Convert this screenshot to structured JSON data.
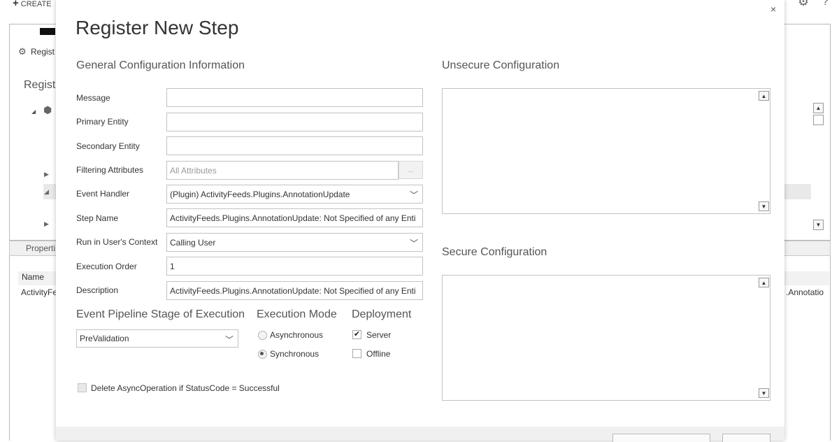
{
  "background": {
    "create_label": "CREATE",
    "register_label": "Regist",
    "registered_heading": "Registe",
    "properties_tab": "Properti",
    "name_column": "Name",
    "row_prefix": "ActivityFe",
    "row_suffix": ".Annotatio"
  },
  "dialog": {
    "title": "Register New Step",
    "close_glyph": "×",
    "general_header": "General Configuration Information",
    "unsecure_header": "Unsecure  Configuration",
    "secure_header": "Secure  Configuration",
    "fields": {
      "message": {
        "label": "Message",
        "value": ""
      },
      "primary_entity": {
        "label": "Primary Entity",
        "value": ""
      },
      "secondary_entity": {
        "label": "Secondary Entity",
        "value": ""
      },
      "filtering_attributes": {
        "label": "Filtering Attributes",
        "value": "All Attributes",
        "button": "..."
      },
      "event_handler": {
        "label": "Event Handler",
        "value": "(Plugin) ActivityFeeds.Plugins.AnnotationUpdate"
      },
      "step_name": {
        "label": "Step Name",
        "value": "ActivityFeeds.Plugins.AnnotationUpdate: Not Specified of any Enti"
      },
      "run_in_user_context": {
        "label": "Run in User's Context",
        "value": "Calling User"
      },
      "execution_order": {
        "label": "Execution Order",
        "value": "1"
      },
      "description": {
        "label": "Description",
        "value": "ActivityFeeds.Plugins.AnnotationUpdate: Not Specified of any Enti"
      }
    },
    "pipeline": {
      "header": "Event Pipeline Stage of Execution",
      "value": "PreValidation"
    },
    "execution_mode": {
      "header": "Execution Mode",
      "options": [
        {
          "label": "Asynchronous",
          "selected": false
        },
        {
          "label": "Synchronous",
          "selected": true
        }
      ]
    },
    "deployment": {
      "header": "Deployment",
      "options": [
        {
          "label": "Server",
          "checked": true
        },
        {
          "label": "Offline",
          "checked": false
        }
      ]
    },
    "delete_async": {
      "label": "Delete AsyncOperation if StatusCode = Successful",
      "checked": false
    }
  },
  "icons": {
    "close": "close-icon",
    "chevron": "chevron-down-icon",
    "scroll_up": "scroll-up-icon",
    "scroll_down": "scroll-down-icon",
    "gear": "gear-icon",
    "help": "help-icon",
    "plus": "plus-icon",
    "register": "register-icon",
    "solution": "solution-box-icon"
  }
}
